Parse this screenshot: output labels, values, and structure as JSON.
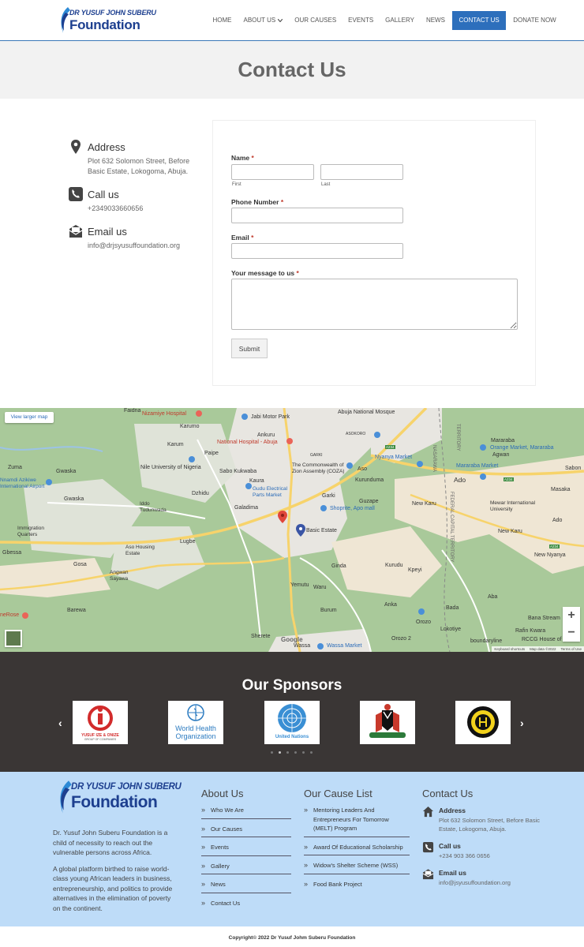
{
  "brand": {
    "line1": "DR YUSUF JOHN SUBERU",
    "line2": "Foundation"
  },
  "nav": {
    "home": "HOME",
    "about": "ABOUT US",
    "causes": "OUR CAUSES",
    "events": "EVENTS",
    "gallery": "GALLERY",
    "news": "NEWS",
    "contact": "CONTACT US",
    "donate": "DONATE NOW"
  },
  "page_title": "Contact Us",
  "contact_info": {
    "address_title": "Address",
    "address_text": "Plot 632 Solomon Street, Before Basic Estate, Lokogoma, Abuja.",
    "call_title": "Call us",
    "call_text": "+2349033660656",
    "email_title": "Email us",
    "email_text": "info@drjsyusuffoundation.org"
  },
  "form": {
    "name_label": "Name",
    "required_mark": "*",
    "first_label": "First",
    "last_label": "Last",
    "phone_label": "Phone Number",
    "email_label": "Email",
    "message_label": "Your message to us",
    "submit_label": "Submit"
  },
  "map": {
    "view_larger": "View larger map",
    "labels": {
      "faidna": "Faidna",
      "nizamiye": "Nizamiye Hospital",
      "jabi": "Jabi Motor Park",
      "mosque": "Abuja National Mosque",
      "karumo": "Karumo",
      "ankuru": "Ankuru",
      "asokoro": "ASOKORO",
      "national_hospital": "National Hospital - Abuja",
      "karum": "Karum",
      "paipe": "Paipe",
      "garki_small": "GARKI",
      "commonwealth": "The Commonwealth of Zion Assembly (COZA)",
      "nyanya": "Nyanya Market",
      "orange": "Orange Market, Mararaba",
      "mararaba": "Mararaba",
      "agwan": "Agwan",
      "zuma": "Zuma",
      "gwaska": "Gwaska",
      "nile": "Nile University of Nigeria",
      "sabo": "Sabo Kukwaba",
      "aso": "Aso",
      "kurunduma": "Kurunduma",
      "mararaba_market": "Mararaba Market",
      "nnamdi": "Nnamdi Azikiwe International Airport",
      "kaura": "Kaura",
      "gudu": "Gudu Electrical Parts Market",
      "ado": "Ado",
      "sabon": "Sabon",
      "dzhidu": "Dzhidu",
      "gwaska2": "Gwaska",
      "garki": "Garki",
      "guzape": "Guzape",
      "shoprite": "Shoprite, Apo mall",
      "new_karu": "New Karu",
      "mewar": "Mewar International University",
      "masaka": "Masaka",
      "iddo": "Iddo Tudunwada",
      "galadima": "Galadima",
      "basic_estate": "Basic Estate",
      "immigration": "Immigration Quarters",
      "lugbe": "Lugbe",
      "aso_housing": "Aso Housing Estate",
      "new_karu2": "New Karu",
      "ado2": "Ado",
      "gbessa": "Gbessa",
      "gosa": "Gosa",
      "angwan": "Angwan Sayawa",
      "ginda": "Ginda",
      "kurudu": "Kurudu",
      "kpeyi": "Kpeyi",
      "new_nyanya": "New Nyanya",
      "yemutu": "Yemutu",
      "waru": "Waru",
      "anka": "Anka",
      "aba": "Aba",
      "rose": "neRose",
      "barewa": "Barewa",
      "burum": "Burum",
      "bada": "Bada",
      "bana": "Bana Stream",
      "orozo": "Orozo",
      "lokotiye": "Lokotiye",
      "rafin": "Rafin Kwara",
      "sherete": "Sherete",
      "wassa": "Wassa",
      "wassa_market": "Wassa Market",
      "orozo2": "Orozo 2",
      "boundaryline": "boundaryline",
      "rccg": "RCCG House of",
      "nasarawa": "NASARAWA",
      "territory": "TERRITORY",
      "fct": "FEDERAL CAPITAL TERRITORY",
      "a234": "A234"
    },
    "google": "Google",
    "attribution": {
      "shortcuts": "Keyboard shortcuts",
      "data": "Map data ©2022",
      "terms": "Terms of Use"
    },
    "zoom_in": "+",
    "zoom_out": "−"
  },
  "sponsors": {
    "title": "Our Sponsors",
    "prev": "‹",
    "next": "›",
    "logos": [
      {
        "line1": "YUSUF IZE & ONIZE",
        "line2": "GROUP OF COMPANIES"
      },
      {
        "line1": "World Health",
        "line2": "Organization"
      },
      {
        "line1": "United Nations"
      },
      {
        "line1": ""
      },
      {
        "line1": ""
      }
    ]
  },
  "footer": {
    "about_p1": "Dr. Yusuf John Suberu Foundation is a child of necessity to reach out the vulnerable persons across Africa.",
    "about_p2": "A global platform birthed to raise world-class young African leaders in business, entrepreneurship, and politics to provide alternatives in the elimination of poverty on the continent.",
    "about_title": "About Us",
    "about_links": [
      "Who We Are",
      "Our Causes",
      "Events",
      "Gallery",
      "News",
      "Contact Us"
    ],
    "cause_title": "Our Cause List",
    "cause_links": [
      "Mentoring Leaders And Entrepreneurs For Tomorrow (MELT) Program",
      "Award Of Educational Scholarship",
      "Widow's Shelter Scheme (WSS)",
      "Food Bank Project"
    ],
    "contact_title": "Contact Us",
    "address_title": "Address",
    "address_text": "Plot 632 Solomon Street, Before Basic Estate, Lokogoma, Abuja.",
    "call_title": "Call us",
    "call_text": "+234 903 366 0656",
    "email_title": "Email us",
    "email_text": "info@jsyusuffoundation.org"
  },
  "copyright": "Copyright© 2022 Dr Yusuf Johm Suberu Foundation",
  "colors": {
    "accent": "#2d6fbc",
    "brand": "#1d3f8f",
    "footer_bg": "#bedcf8",
    "sponsor_bg": "#3a3635"
  }
}
